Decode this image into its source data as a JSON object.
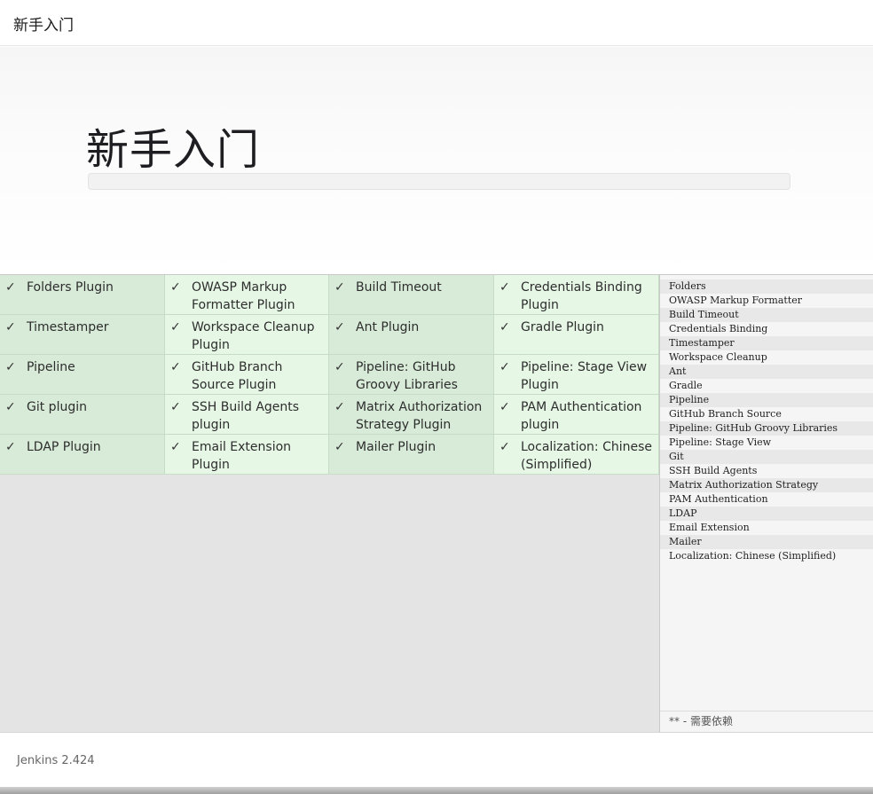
{
  "window": {
    "title": "新手入门"
  },
  "hero": {
    "heading": "新手入门",
    "progress": 0
  },
  "plugins": [
    [
      "Folders Plugin",
      "OWASP Markup Formatter Plugin",
      "Build Timeout",
      "Credentials Binding Plugin"
    ],
    [
      "Timestamper",
      "Workspace Cleanup Plugin",
      "Ant Plugin",
      "Gradle Plugin"
    ],
    [
      "Pipeline",
      "GitHub Branch Source Plugin",
      "Pipeline: GitHub Groovy Libraries",
      "Pipeline: Stage View Plugin"
    ],
    [
      "Git plugin",
      "SSH Build Agents plugin",
      "Matrix Authorization Strategy Plugin",
      "PAM Authentication plugin"
    ],
    [
      "LDAP Plugin",
      "Email Extension Plugin",
      "Mailer Plugin",
      "Localization: Chinese (Simplified)"
    ]
  ],
  "status_icon": "check-icon",
  "install_log": [
    "Folders",
    "OWASP Markup Formatter",
    "Build Timeout",
    "Credentials Binding",
    "Timestamper",
    "Workspace Cleanup",
    "Ant",
    "Gradle",
    "Pipeline",
    "GitHub Branch Source",
    "Pipeline: GitHub Groovy Libraries",
    "Pipeline: Stage View",
    "Git",
    "SSH Build Agents",
    "Matrix Authorization Strategy",
    "PAM Authentication",
    "LDAP",
    "Email Extension",
    "Mailer",
    "Localization: Chinese (Simplified)"
  ],
  "log_legend": "** - 需要依赖",
  "footer": {
    "version": "Jenkins 2.424"
  },
  "colors": {
    "success_cell_dark": "#d8ebd8",
    "success_cell_light": "#e6f7e6"
  }
}
